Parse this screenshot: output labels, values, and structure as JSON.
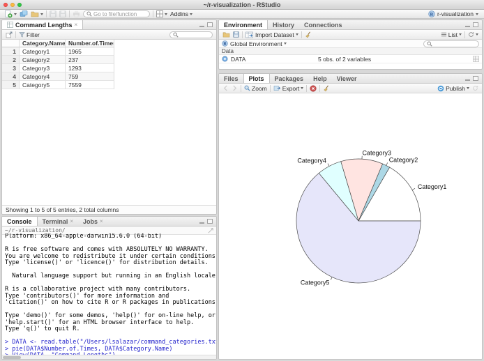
{
  "window": {
    "title": "~/r-visualization - RStudio",
    "project_label": "r-visualization"
  },
  "toolbar": {
    "goto_placeholder": "Go to file/function",
    "addins_label": "Addins"
  },
  "data_viewer": {
    "tab_label": "Command Lengths",
    "filter_label": "Filter",
    "columns": [
      "Category.Name",
      "Number.of.Times"
    ],
    "rows": [
      [
        "1",
        "Category1",
        "1965"
      ],
      [
        "2",
        "Category2",
        "237"
      ],
      [
        "3",
        "Category3",
        "1293"
      ],
      [
        "4",
        "Category4",
        "759"
      ],
      [
        "5",
        "Category5",
        "7559"
      ]
    ],
    "status": "Showing 1 to 5 of 5 entries, 2 total columns"
  },
  "console": {
    "tabs": [
      "Console",
      "Terminal",
      "Jobs"
    ],
    "path": "~/r-visualization/",
    "lines": [
      {
        "text": "Platform: x86_64-apple-darwin15.6.0 (64-bit)",
        "kind": "output"
      },
      {
        "text": "",
        "kind": "output"
      },
      {
        "text": "R is free software and comes with ABSOLUTELY NO WARRANTY.",
        "kind": "output"
      },
      {
        "text": "You are welcome to redistribute it under certain conditions.",
        "kind": "output"
      },
      {
        "text": "Type 'license()' or 'licence()' for distribution details.",
        "kind": "output"
      },
      {
        "text": "",
        "kind": "output"
      },
      {
        "text": "  Natural language support but running in an English locale",
        "kind": "output"
      },
      {
        "text": "",
        "kind": "output"
      },
      {
        "text": "R is a collaborative project with many contributors.",
        "kind": "output"
      },
      {
        "text": "Type 'contributors()' for more information and",
        "kind": "output"
      },
      {
        "text": "'citation()' on how to cite R or R packages in publications.",
        "kind": "output"
      },
      {
        "text": "",
        "kind": "output"
      },
      {
        "text": "Type 'demo()' for some demos, 'help()' for on-line help, or",
        "kind": "output"
      },
      {
        "text": "'help.start()' for an HTML browser interface to help.",
        "kind": "output"
      },
      {
        "text": "Type 'q()' to quit R.",
        "kind": "output"
      },
      {
        "text": "",
        "kind": "output"
      },
      {
        "text": "> DATA <- read.table(\"/Users/lsalazar/command_categories.txt\", header=TRUE)",
        "kind": "command"
      },
      {
        "text": "> pie(DATA$Number.of.Times, DATA$Category.Name)",
        "kind": "command"
      },
      {
        "text": "> View(DATA, \"Command Lengths\")",
        "kind": "command"
      },
      {
        "text": "> ",
        "kind": "command"
      }
    ]
  },
  "environment": {
    "tabs": [
      "Environment",
      "History",
      "Connections"
    ],
    "import_label": "Import Dataset",
    "list_label": "List",
    "scope_label": "Global Environment",
    "section_label": "Data",
    "objects": [
      {
        "name": "DATA",
        "value": "5 obs. of 2 variables"
      }
    ]
  },
  "plots": {
    "tabs": [
      "Files",
      "Plots",
      "Packages",
      "Help",
      "Viewer"
    ],
    "zoom_label": "Zoom",
    "export_label": "Export",
    "publish_label": "Publish"
  },
  "chart_data": {
    "type": "pie",
    "title": "",
    "categories": [
      "Category1",
      "Category2",
      "Category3",
      "Category4",
      "Category5"
    ],
    "values": [
      1965,
      237,
      1293,
      759,
      7559
    ],
    "colors": [
      "#FFFFFF",
      "#ADD8E6",
      "#FFE4E1",
      "#E0FFFF",
      "#E6E6FA"
    ],
    "start_angle_deg": 0,
    "direction": "counterclockwise",
    "border_color": "#4a4a4a",
    "label_color": "#111111",
    "legend": false
  }
}
